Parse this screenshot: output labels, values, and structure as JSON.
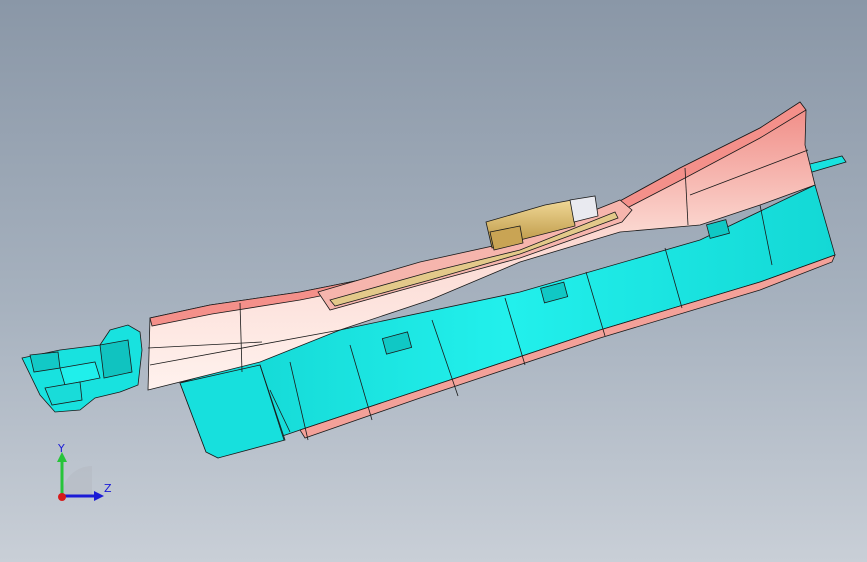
{
  "viewport": {
    "background_top": "#8a97a7",
    "background_bottom": "#c9cfd7"
  },
  "model": {
    "colors": {
      "housing": "#18e6e2",
      "housing_shade": "#10c9c6",
      "cover": "#f39a94",
      "cover_highlight": "#fde7e2",
      "clip": "#d9b66a",
      "edge": "#1a1a1a"
    }
  },
  "triad": {
    "y_label": "Y",
    "z_label": "Z",
    "y_color": "#27c43a",
    "z_color": "#1b1bd6",
    "x_color": "#d61b1b"
  }
}
